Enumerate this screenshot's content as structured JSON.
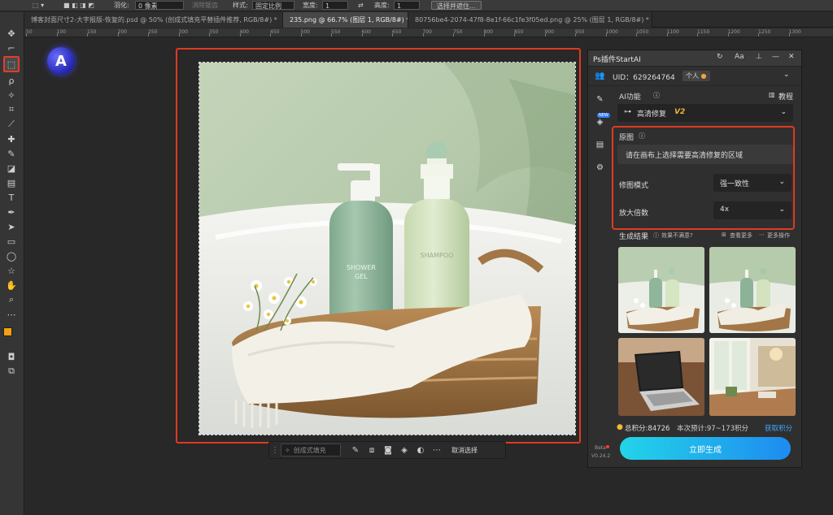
{
  "options_bar": {
    "feather_label": "羽化:",
    "feather_value": "0 像素",
    "antialias_label": "消除锯齿",
    "style_label": "样式:",
    "style_value": "固定比例",
    "width_label": "宽度:",
    "width_value": "1",
    "height_label": "高度:",
    "height_value": "1",
    "select_subject_label": "选择并遮住..."
  },
  "tabs": [
    {
      "label": "博客封面尺寸2-大字报版-恢复的.psd @ 50% (创成式填充平替插件推荐, RGB/8#) *",
      "close": "×"
    },
    {
      "label": "235.png @ 66.7% (图层 1, RGB/8#) *",
      "close": "×"
    },
    {
      "label": "80756be4-2074-47f8-8e1f-66c1fe3f05ed.png @ 25% (图层 1, RGB/8#) *",
      "close": "×"
    }
  ],
  "ruler_ticks": [
    "50",
    "100",
    "150",
    "200",
    "250",
    "300",
    "350",
    "400",
    "450",
    "500",
    "550",
    "600",
    "650",
    "700",
    "750",
    "800",
    "850",
    "900",
    "950",
    "1000",
    "1050",
    "1100",
    "1150",
    "1200",
    "1250",
    "1300"
  ],
  "product": {
    "left_line1": "SHOWER",
    "left_line2": "GEL",
    "right_label": "SHAMPOO"
  },
  "taskbar": {
    "generative_fill_label": "创成式填充",
    "deselect_label": "取消选择"
  },
  "panel": {
    "title": "Ps插件StartAI",
    "uid_label": "UID：629264764",
    "account_type": "个人",
    "ai_function_label": "AI功能",
    "tutorial_label": "教程",
    "feature_name": "高清修复",
    "feature_version": "V2",
    "original_label": "原图",
    "original_hint": "请在画布上选择需要高清修复的区域",
    "repair_mode_label": "修图模式",
    "repair_mode_value": "强一致性",
    "scale_label": "放大倍数",
    "scale_value": "4x",
    "results_label": "生成结果",
    "unsatisfied_label": "效果不满意?",
    "view_more_label": "查看更多",
    "more_ops_label": "更多操作",
    "points_label": "总积分:84726",
    "estimate_label": "本次预计:97~173积分",
    "get_points_label": "获取积分",
    "generate_button": "立即生成",
    "beta_label": "Beta",
    "version_label": "V0.24.2",
    "new_badge": "NEW"
  },
  "colors": {
    "accent_red": "#e03a23",
    "button_start": "#23d4e8",
    "button_end": "#1e8bf0",
    "link_blue": "#3da8ff",
    "foreground_swatch": "#f5a011"
  }
}
